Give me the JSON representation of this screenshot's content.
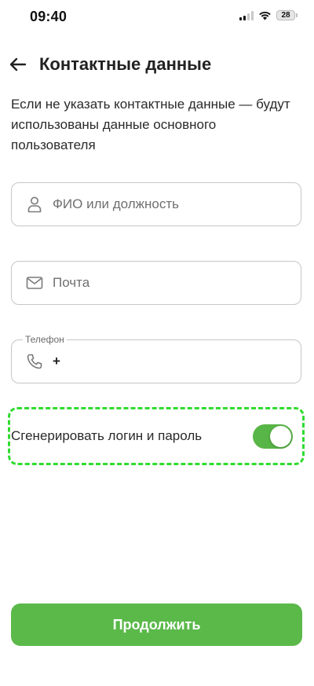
{
  "status_bar": {
    "time": "09:40",
    "battery": "28"
  },
  "header": {
    "title": "Контактные данные",
    "back_icon": "arrow-left-icon"
  },
  "description": "Если не указать контактные данные — будут использованы данные основного пользователя",
  "fields": {
    "name": {
      "placeholder": "ФИО или должность",
      "icon": "person-icon"
    },
    "email": {
      "placeholder": "Почта",
      "icon": "mail-icon"
    },
    "phone": {
      "label": "Телефон",
      "value": "+",
      "icon": "phone-icon"
    }
  },
  "toggle": {
    "label": "Сгенерировать логин и пароль",
    "on": true,
    "color": "#58b547",
    "highlight_color": "#2fdc2f"
  },
  "continue_button": {
    "label": "Продолжить",
    "color": "#5bb94a"
  }
}
